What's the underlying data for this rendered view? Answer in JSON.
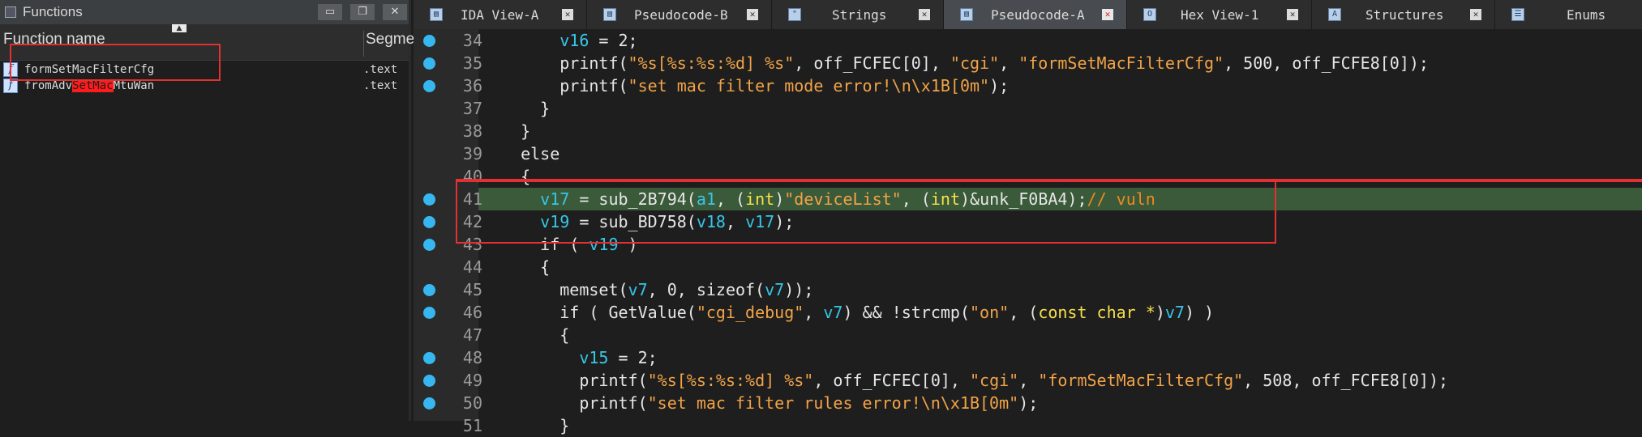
{
  "functions_pane": {
    "title": "Functions",
    "buttons": {
      "restore": "▭",
      "float": "❐",
      "close": "✕"
    },
    "header": {
      "name_col": "Function name",
      "segment_col": "Segme",
      "sort_arrow": "▲"
    },
    "rows": [
      {
        "icon": "f",
        "name": "formSetMacFilterCfg",
        "segment": ".text"
      },
      {
        "icon": "f",
        "name_before": "fromAdv",
        "name_highlight": "SetMac",
        "name_after": "MtuWan",
        "segment": ".text"
      }
    ]
  },
  "tabs": [
    {
      "icon": "▤",
      "label": "IDA View-A",
      "close": "✕",
      "active": false
    },
    {
      "icon": "▤",
      "label": "Pseudocode-B",
      "close": "✕",
      "active": false
    },
    {
      "icon": "\"",
      "label": "Strings",
      "close": "✕",
      "active": false
    },
    {
      "icon": "▤",
      "label": "Pseudocode-A",
      "close": "✕",
      "active": true
    },
    {
      "icon": "O",
      "label": "Hex View-1",
      "close": "✕",
      "active": false
    },
    {
      "icon": "A",
      "label": "Structures",
      "close": "✕",
      "active": false
    },
    {
      "icon": "☰",
      "label": "Enums",
      "close": "",
      "active": false
    }
  ],
  "code": {
    "lines": [
      {
        "n": "34",
        "bp": true,
        "t": [
          [
            "",
            "      "
          ],
          [
            "v",
            "v16"
          ],
          [
            "f",
            " = 2;"
          ]
        ]
      },
      {
        "n": "35",
        "bp": true,
        "t": [
          [
            "",
            "      "
          ],
          [
            "f",
            "printf("
          ],
          [
            "s",
            "\"%s[%s:%s:%d] %s\""
          ],
          [
            "f",
            ", off_FCFEC[0], "
          ],
          [
            "s",
            "\"cgi\""
          ],
          [
            "f",
            ", "
          ],
          [
            "s",
            "\"formSetMacFilterCfg\""
          ],
          [
            "f",
            ", 500, off_FCFE8[0]);"
          ]
        ]
      },
      {
        "n": "36",
        "bp": true,
        "t": [
          [
            "",
            "      "
          ],
          [
            "f",
            "printf("
          ],
          [
            "s",
            "\"set mac filter mode error!\\n\\x1B[0m\""
          ],
          [
            "f",
            ");"
          ]
        ]
      },
      {
        "n": "37",
        "bp": false,
        "t": [
          [
            "",
            "    "
          ],
          [
            "f",
            "}"
          ]
        ]
      },
      {
        "n": "38",
        "bp": false,
        "t": [
          [
            "",
            "  "
          ],
          [
            "f",
            "}"
          ]
        ]
      },
      {
        "n": "39",
        "bp": false,
        "t": [
          [
            "",
            "  "
          ],
          [
            "f",
            "else"
          ]
        ]
      },
      {
        "n": "40",
        "bp": false,
        "t": [
          [
            "",
            "  "
          ],
          [
            "f",
            "{"
          ]
        ]
      },
      {
        "n": "41",
        "bp": true,
        "current": true,
        "t": [
          [
            "",
            "    "
          ],
          [
            "v",
            "v17"
          ],
          [
            "f",
            " = sub_2B794("
          ],
          [
            "v",
            "a1"
          ],
          [
            "f",
            ", ("
          ],
          [
            "k",
            "int"
          ],
          [
            "f",
            ")"
          ],
          [
            "s",
            "\"deviceList\""
          ],
          [
            "f",
            ", ("
          ],
          [
            "k",
            "int"
          ],
          [
            "f",
            ")&unk_F0BA4);"
          ],
          [
            "c",
            "// vuln"
          ]
        ]
      },
      {
        "n": "42",
        "bp": true,
        "t": [
          [
            "",
            "    "
          ],
          [
            "v",
            "v19"
          ],
          [
            "f",
            " = sub_BD758("
          ],
          [
            "v",
            "v18"
          ],
          [
            "f",
            ", "
          ],
          [
            "v",
            "v17"
          ],
          [
            "f",
            ");"
          ]
        ]
      },
      {
        "n": "43",
        "bp": true,
        "t": [
          [
            "",
            "    "
          ],
          [
            "f",
            "if ( "
          ],
          [
            "v",
            "v19"
          ],
          [
            "f",
            " )"
          ]
        ]
      },
      {
        "n": "44",
        "bp": false,
        "t": [
          [
            "",
            "    "
          ],
          [
            "f",
            "{"
          ]
        ]
      },
      {
        "n": "45",
        "bp": true,
        "t": [
          [
            "",
            "      "
          ],
          [
            "f",
            "memset("
          ],
          [
            "v",
            "v7"
          ],
          [
            "f",
            ", 0, sizeof("
          ],
          [
            "v",
            "v7"
          ],
          [
            "f",
            "));"
          ]
        ]
      },
      {
        "n": "46",
        "bp": true,
        "t": [
          [
            "",
            "      "
          ],
          [
            "f",
            "if ( GetValue("
          ],
          [
            "s",
            "\"cgi_debug\""
          ],
          [
            "f",
            ", "
          ],
          [
            "v",
            "v7"
          ],
          [
            "f",
            ") && !strcmp("
          ],
          [
            "s",
            "\"on\""
          ],
          [
            "f",
            ", ("
          ],
          [
            "k",
            "const char *"
          ],
          [
            "f",
            ")"
          ],
          [
            "v",
            "v7"
          ],
          [
            "f",
            ") )"
          ]
        ]
      },
      {
        "n": "47",
        "bp": false,
        "t": [
          [
            "",
            "      "
          ],
          [
            "f",
            "{"
          ]
        ]
      },
      {
        "n": "48",
        "bp": true,
        "t": [
          [
            "",
            "        "
          ],
          [
            "v",
            "v15"
          ],
          [
            "f",
            " = 2;"
          ]
        ]
      },
      {
        "n": "49",
        "bp": true,
        "t": [
          [
            "",
            "        "
          ],
          [
            "f",
            "printf("
          ],
          [
            "s",
            "\"%s[%s:%s:%d] %s\""
          ],
          [
            "f",
            ", off_FCFEC[0], "
          ],
          [
            "s",
            "\"cgi\""
          ],
          [
            "f",
            ", "
          ],
          [
            "s",
            "\"formSetMacFilterCfg\""
          ],
          [
            "f",
            ", 508, off_FCFE8[0]);"
          ]
        ]
      },
      {
        "n": "50",
        "bp": true,
        "t": [
          [
            "",
            "        "
          ],
          [
            "f",
            "printf("
          ],
          [
            "s",
            "\"set mac filter rules error!\\n\\x1B[0m\""
          ],
          [
            "f",
            ");"
          ]
        ]
      },
      {
        "n": "51",
        "bp": false,
        "t": [
          [
            "",
            "      "
          ],
          [
            "f",
            "}"
          ]
        ]
      }
    ]
  },
  "colors": {
    "breakpoint": "#37b7f0",
    "current_line": "#3a5a3a",
    "annotation_box": "#e33030",
    "highlight": "#ff1b1b"
  }
}
